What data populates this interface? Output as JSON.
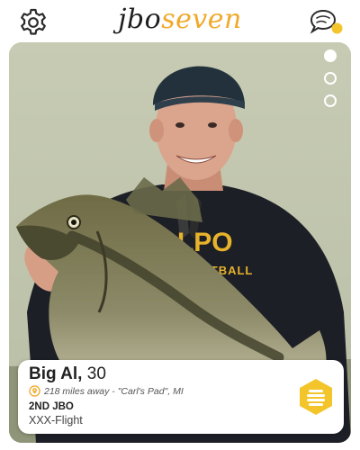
{
  "header": {
    "logo_part1": "jbo",
    "logo_part2": "seven",
    "icons": {
      "settings": "gear-icon",
      "messages": "chat-bubble-icon"
    },
    "colors": {
      "accent": "#f4c52a",
      "logo_dark": "#1f1f1f",
      "logo_accent": "#f0a92a"
    }
  },
  "card": {
    "photo_count": 3,
    "active_photo": 1,
    "photo_shirt_text_1": "VALPO",
    "photo_shirt_text_2": "FOOTBALL"
  },
  "profile": {
    "name": "Big Al,",
    "age": "30",
    "distance": "218 miles away - \"Carl's Pad\", MI",
    "level": "2ND JBO",
    "group": "XXX-Flight"
  },
  "action": {
    "icon": "hive-hexagon-icon",
    "color": "#f4c52a"
  }
}
